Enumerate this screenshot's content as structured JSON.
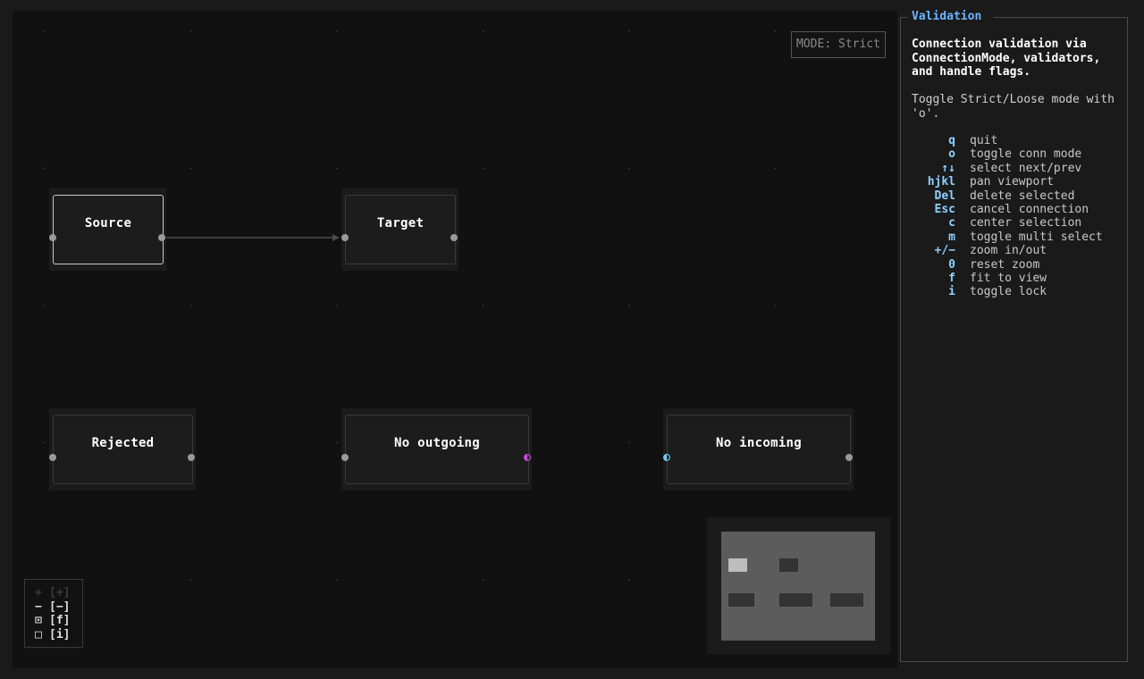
{
  "canvas": {
    "mode_label": "MODE: Strict",
    "nodes": [
      {
        "id": "source",
        "label": "Source",
        "selected": true
      },
      {
        "id": "target",
        "label": "Target",
        "selected": false
      },
      {
        "id": "rejected",
        "label": "Rejected",
        "selected": false
      },
      {
        "id": "no_outgoing",
        "label": "No outgoing",
        "selected": false
      },
      {
        "id": "no_incoming",
        "label": "No incoming",
        "selected": false
      }
    ],
    "edges": [
      {
        "from": "source",
        "to": "target"
      }
    ]
  },
  "controls": [
    {
      "glyph": "+",
      "label": "[+]",
      "disabled": true
    },
    {
      "glyph": "−",
      "label": "[−]",
      "disabled": false
    },
    {
      "glyph": "⊡",
      "label": "[f]",
      "disabled": false
    },
    {
      "glyph": "□",
      "label": "[i]",
      "disabled": false
    }
  ],
  "panel": {
    "title": "Validation",
    "description": "Connection validation via ConnectionMode, validators, and handle flags.",
    "hint": "Toggle Strict/Loose mode with 'o'.",
    "keys": [
      {
        "key": "q",
        "desc": "quit"
      },
      {
        "key": "o",
        "desc": "toggle conn mode"
      },
      {
        "key": "↑↓",
        "desc": "select next/prev"
      },
      {
        "key": "hjkl",
        "desc": "pan viewport"
      },
      {
        "key": "Del",
        "desc": "delete selected"
      },
      {
        "key": "Esc",
        "desc": "cancel connection"
      },
      {
        "key": "c",
        "desc": "center selection"
      },
      {
        "key": "m",
        "desc": "toggle multi select"
      },
      {
        "key": "+/−",
        "desc": "zoom in/out"
      },
      {
        "key": "0",
        "desc": "reset zoom"
      },
      {
        "key": "f",
        "desc": "fit to view"
      },
      {
        "key": "i",
        "desc": "toggle lock"
      }
    ]
  },
  "colors": {
    "accent": "#6cb4ff",
    "key": "#8fd0ff",
    "handle_purple": "#c44fd6",
    "handle_cyan": "#6ad0f0"
  }
}
